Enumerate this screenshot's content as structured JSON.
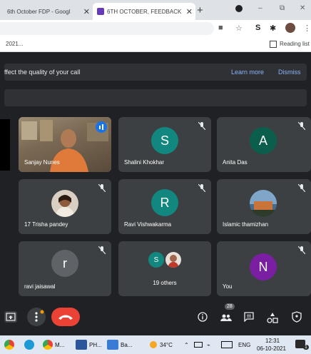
{
  "browser": {
    "tabs": [
      {
        "title": "6th October FDP - Googl"
      },
      {
        "title": "6TH OCTOBER, FEEDBACK"
      }
    ],
    "new_tab": "+",
    "window_controls": [
      "–",
      "⧉",
      "✕"
    ],
    "bookmark_left": "2021...",
    "reading_list": "Reading list"
  },
  "meet": {
    "banner": {
      "message": "ffect the quality of your call",
      "learn_more": "Learn more",
      "dismiss": "Dismiss"
    },
    "participants": [
      {
        "name": "Sanjay Nunes",
        "type": "video",
        "speaking": true
      },
      {
        "name": "Shalini Khokhar",
        "initial": "S",
        "color": "#12877f",
        "muted": true
      },
      {
        "name": "Anita Das",
        "initial": "A",
        "color": "#0b5e4b",
        "muted": true
      },
      {
        "name": "17 Trisha pandey",
        "type": "photo",
        "muted": true
      },
      {
        "name": "Ravi Vishwakarma",
        "initial": "R",
        "color": "#12877f",
        "muted": true
      },
      {
        "name": "Islamic thamizhan",
        "type": "photo",
        "muted": true
      },
      {
        "name": "ravi jaisawal",
        "initial": "r",
        "color": "#5f6368",
        "muted": true
      },
      {
        "name": "19 others",
        "mini_initial": "S",
        "mini_color": "#12877f",
        "type": "others"
      },
      {
        "name": "You",
        "initial": "N",
        "color": "#7b1fa2",
        "muted": true
      }
    ],
    "people_count": "28"
  },
  "taskbar": {
    "items": [
      {
        "label": "M...",
        "icon": "chrome-icon"
      },
      {
        "label": "PH...",
        "icon": "word-icon"
      },
      {
        "label": "Ba...",
        "icon": "photos-icon"
      }
    ],
    "weather": "34°C",
    "language": "ENG",
    "time": "12:31",
    "date": "06-10-2021",
    "notification_count": "1"
  },
  "colors": {
    "meet_bg": "#202124",
    "tile_bg": "#3c4043",
    "accent_blue": "#8ab4f8",
    "end_call_red": "#ea4335"
  }
}
